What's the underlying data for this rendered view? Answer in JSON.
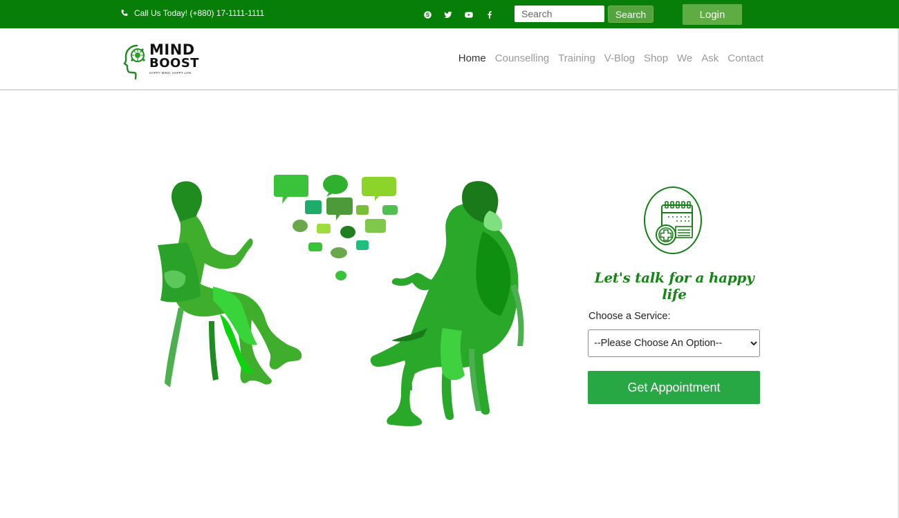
{
  "topbar": {
    "phone_text": "Call Us Today! (+880) 17-1111-1111",
    "socials": [
      "skype-icon",
      "twitter-icon",
      "youtube-icon",
      "facebook-icon"
    ],
    "search_placeholder": "Search",
    "search_button": "Search",
    "login_button": "Login",
    "background_color": "#077e07"
  },
  "brand": {
    "name_line1": "MIND",
    "name_line2": "BOOST",
    "tagline": "HAPPY MIND, HAPPY LIFE"
  },
  "nav": {
    "items": [
      "Home",
      "Counselling",
      "Training",
      "V-Blog",
      "Shop",
      "We",
      "Ask",
      "Contact"
    ],
    "active": "Home"
  },
  "appointment": {
    "icon": "calendar-medical-icon",
    "headline": "Let's talk for a happy life",
    "service_label": "Choose a Service:",
    "select_value": "--Please Choose An Option--",
    "button_label": "Get Appointment",
    "button_color": "#28a745",
    "accent_color": "#138613"
  },
  "hero": {
    "illustration": "counselling-conversation-illustration"
  }
}
